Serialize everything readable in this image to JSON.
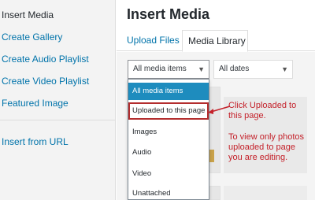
{
  "sidebar": {
    "items": [
      {
        "label": "Insert Media"
      },
      {
        "label": "Create Gallery"
      },
      {
        "label": "Create Audio Playlist"
      },
      {
        "label": "Create Video Playlist"
      },
      {
        "label": "Featured Image"
      },
      {
        "label": "Insert from URL"
      }
    ]
  },
  "header": {
    "title": "Insert Media"
  },
  "tabs": [
    {
      "label": "Upload Files"
    },
    {
      "label": "Media Library"
    }
  ],
  "filters": {
    "media_type": {
      "value": "All media items"
    },
    "dates": {
      "value": "All dates"
    }
  },
  "dropdown": {
    "options": [
      {
        "label": "All media items"
      },
      {
        "label": "Uploaded to this page"
      },
      {
        "label": "Images"
      },
      {
        "label": "Audio"
      },
      {
        "label": "Video"
      },
      {
        "label": "Unattached"
      }
    ]
  },
  "annotation": {
    "line1": "Click Uploaded to this page.",
    "line2": "To view only photos uploaded to page you are editing.",
    "color": "#c4212a"
  },
  "colors": {
    "link": "#0073aa",
    "selected": "#1e8cbe",
    "highlight": "#b32d2e"
  }
}
